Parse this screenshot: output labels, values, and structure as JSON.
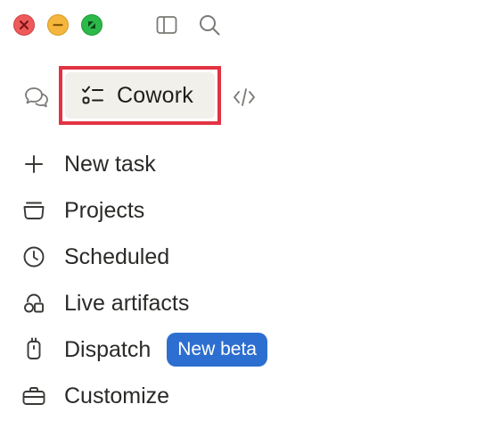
{
  "window": {
    "controls": [
      "close",
      "minimize",
      "maximize"
    ]
  },
  "toolbar": {
    "icons": [
      "sidebar-toggle-icon",
      "search-icon"
    ]
  },
  "modes": {
    "chat_icon": "chat-bubbles-icon",
    "active_label": "Cowork",
    "active_icon": "checklist-icon",
    "code_icon": "code-icon"
  },
  "nav": {
    "items": [
      {
        "label": "New task",
        "icon": "plus-icon"
      },
      {
        "label": "Projects",
        "icon": "folder-icon"
      },
      {
        "label": "Scheduled",
        "icon": "clock-icon"
      },
      {
        "label": "Live artifacts",
        "icon": "shapes-icon"
      },
      {
        "label": "Dispatch",
        "icon": "device-icon",
        "badge": "New beta"
      },
      {
        "label": "Customize",
        "icon": "briefcase-icon"
      }
    ]
  },
  "colors": {
    "highlight_border": "#e23343",
    "active_bg": "#f1f0eb",
    "badge_bg": "#2d6fd0",
    "text": "#2b2a28"
  }
}
